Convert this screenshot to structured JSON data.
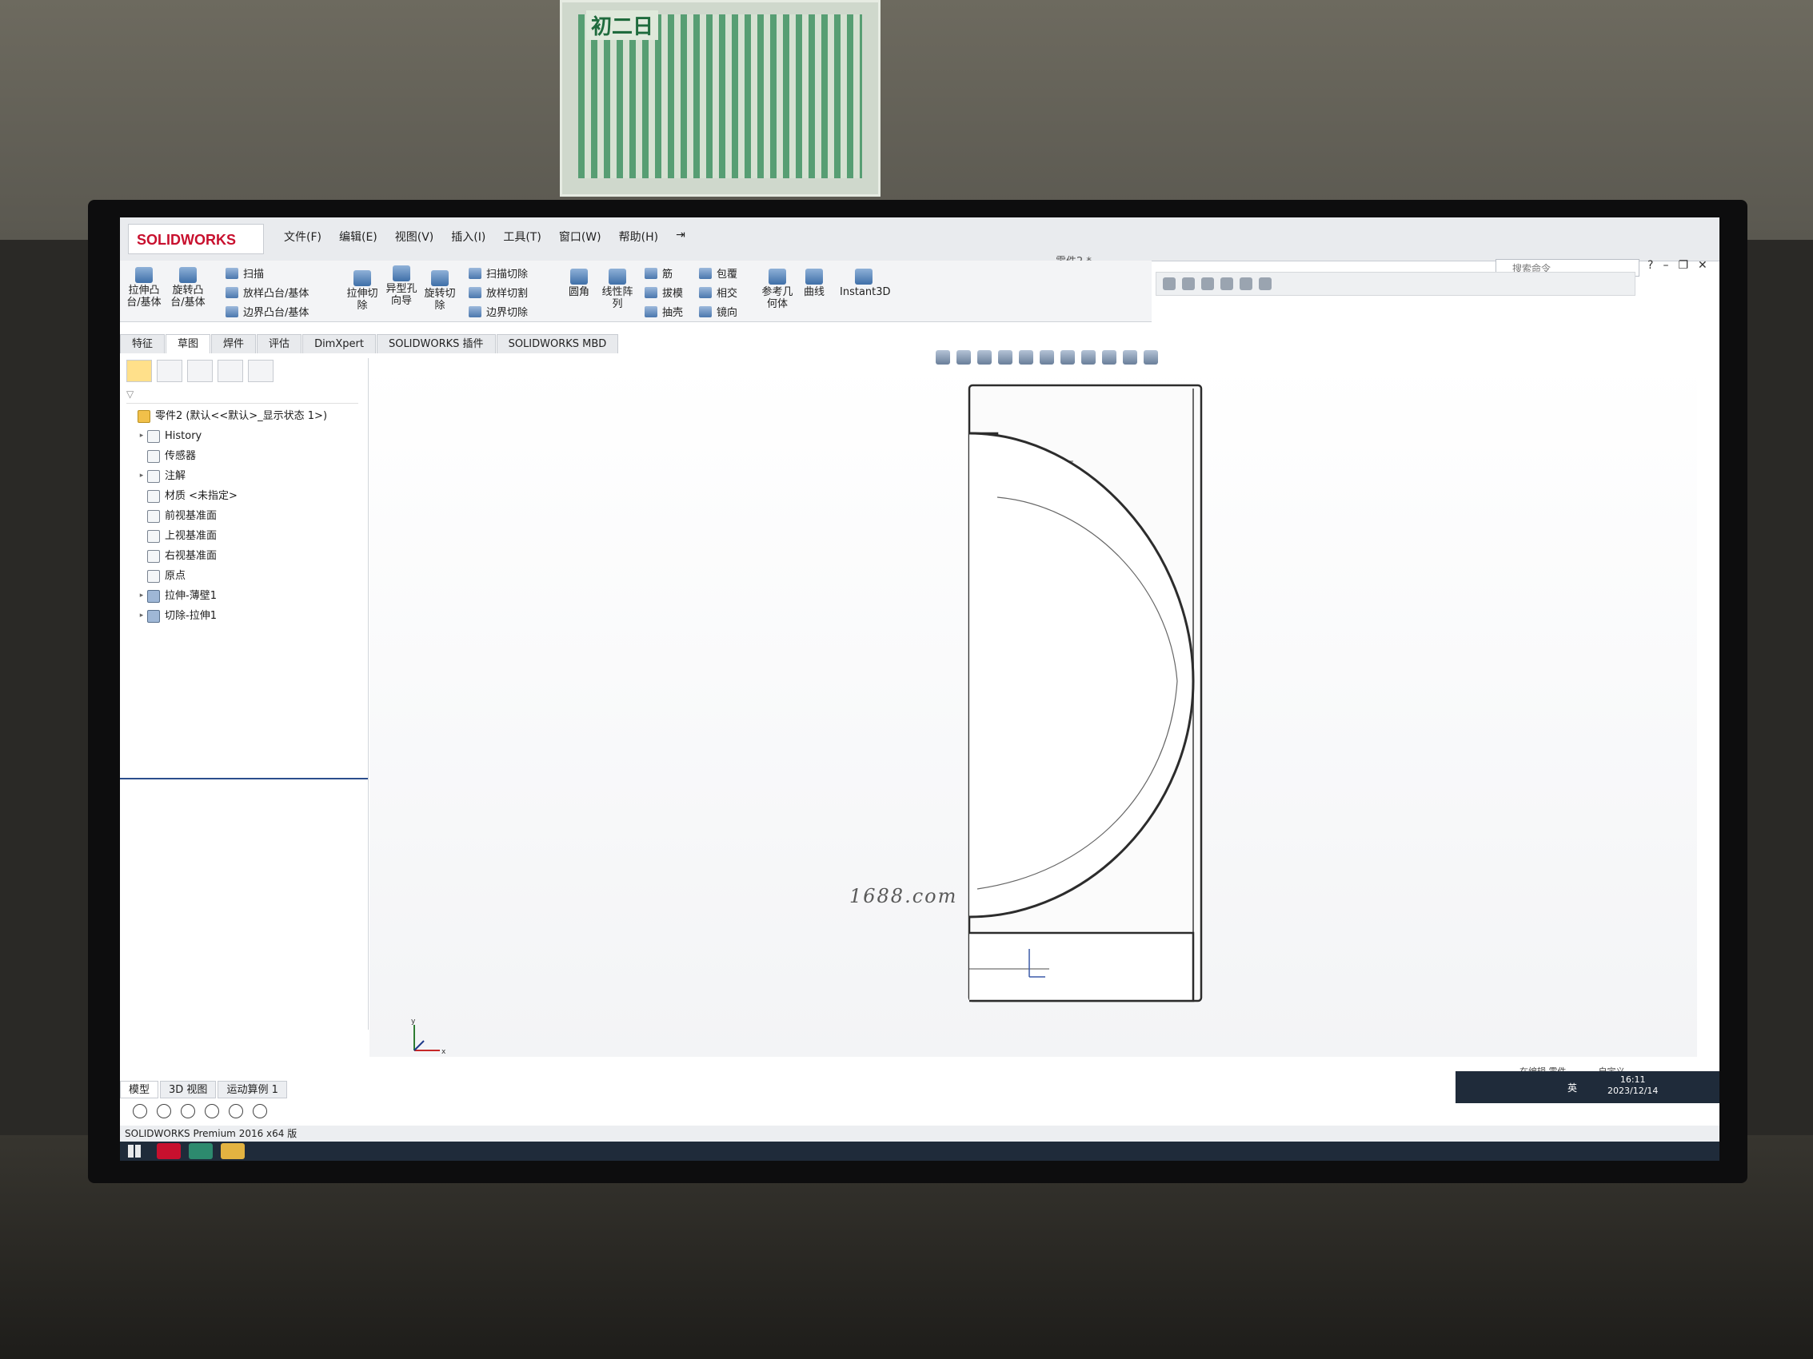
{
  "app": {
    "brand": "SOLIDWORKS",
    "doc_title": "零件2 *",
    "search_placeholder": "搜索命令",
    "product_line": "SOLIDWORKS Premium 2016 x64 版"
  },
  "menu": [
    "文件(F)",
    "编辑(E)",
    "视图(V)",
    "插入(I)",
    "工具(T)",
    "窗口(W)",
    "帮助(H)"
  ],
  "ribbon": {
    "big_buttons": [
      "拉伸凸台/基体",
      "旋转凸台/基体",
      "拉伸切除",
      "异型孔向导",
      "旋转切除",
      "圆角",
      "线性阵列",
      "参考几何体",
      "曲线",
      "Instant3D"
    ],
    "col1": [
      "扫描",
      "放样凸台/基体",
      "边界凸台/基体"
    ],
    "col2": [
      "扫描切除",
      "放样切割",
      "边界切除"
    ],
    "col3": [
      "筋",
      "拔模",
      "抽壳"
    ],
    "col4": [
      "包覆",
      "相交",
      "镜向"
    ]
  },
  "cm_tabs": [
    "特征",
    "草图",
    "焊件",
    "评估",
    "DimXpert",
    "SOLIDWORKS 插件",
    "SOLIDWORKS MBD"
  ],
  "tree": {
    "root": "零件2 (默认<<默认>_显示状态 1>)",
    "items": [
      {
        "label": "History",
        "expandable": true
      },
      {
        "label": "传感器",
        "expandable": false
      },
      {
        "label": "注解",
        "expandable": true
      },
      {
        "label": "材质 <未指定>",
        "expandable": false
      },
      {
        "label": "前视基准面",
        "expandable": false
      },
      {
        "label": "上视基准面",
        "expandable": false
      },
      {
        "label": "右视基准面",
        "expandable": false
      },
      {
        "label": "原点",
        "expandable": false
      },
      {
        "label": "拉伸-薄壁1",
        "expandable": true
      },
      {
        "label": "切除-拉伸1",
        "expandable": true
      }
    ]
  },
  "watermark": "1688.com",
  "triad": {
    "x": "x",
    "y": "y"
  },
  "bottom_tabs": [
    "模型",
    "3D 视图",
    "运动算例 1"
  ],
  "status": {
    "editing": "在编辑 零件",
    "custom": "自定义"
  },
  "taskbar": {
    "time": "16:11",
    "date": "2023/12/14",
    "ime": "英"
  },
  "poster": {
    "title": "初二日"
  }
}
